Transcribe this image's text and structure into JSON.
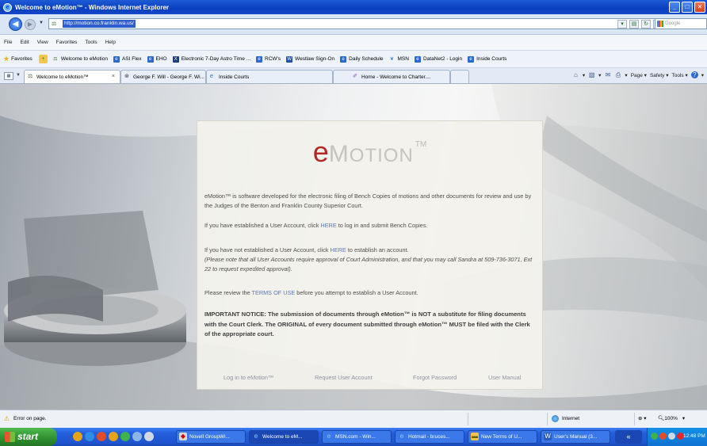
{
  "window": {
    "title": "Welcome to eMotion™ - Windows Internet Explorer"
  },
  "address": {
    "url": "http://motion.co.franklin.wa.us/",
    "search_placeholder": "Google"
  },
  "menu": [
    "File",
    "Edit",
    "View",
    "Favorites",
    "Tools",
    "Help"
  ],
  "favorites": {
    "label": "Favorites",
    "items": [
      "Welcome to eMotion",
      "ASI Flex",
      "EHO",
      "Electronic 7-Day Astro Time ...",
      "RCW's",
      "Westlaw Sign-On",
      "Daily Schedule",
      "MSN",
      "DataNet2 - Login",
      "Inside Courts"
    ]
  },
  "tabs": [
    "Welcome to eMotion™",
    "George F. Will - George F. Wi...",
    "Inside Courts",
    "Home - Welcome to Charter...."
  ],
  "toolbar": {
    "page": "Page",
    "safety": "Safety",
    "tools": "Tools"
  },
  "page": {
    "logo_e": "e",
    "logo_m": "M",
    "logo_rest": "OTION",
    "logo_tm": "TM",
    "intro": "eMotion™ is software developed for the electronic filing of Bench Copies of motions and other documents for review and use by the Judges of the Benton and Franklin County Superior Court.",
    "login_pre": "If you have established a User Account, click ",
    "login_link": "HERE",
    "login_post": " to log in and submit Bench Copies.",
    "register_pre": "If you have not established a User Account, click ",
    "register_link": "HERE",
    "register_post": " to establish an account.",
    "note": "(Please note that all User Accounts require approval of Court Administration, and that you may call Sandra at 509-736-3071, Ext 22 to request expedited approval).",
    "terms_pre": "Please review the ",
    "terms_link": "TERMS OF USE",
    "terms_post": " before you attempt to establish a User Account.",
    "notice": "IMPORTANT NOTICE: The submission of documents through eMotion™ is NOT a substitute for filing documents with the Court Clerk. The ORIGINAL of every document submitted through eMotion™ MUST be filed with the Clerk of the appropriate court.",
    "nav": [
      "Log in to eMotion™",
      "Request User Account",
      "Forgot Password",
      "User Manual"
    ]
  },
  "status": {
    "message": "Error on page.",
    "zone": "Internet",
    "zoom": "100%"
  },
  "taskbar": {
    "start": "start",
    "tasks": [
      "Novell GroupWi...",
      "Welcome to eM...",
      "MSN.com - Win...",
      "Hotmail - bruces...",
      "New Terms of U...",
      "User's Manual (3..."
    ],
    "clock": "12:48 PM"
  }
}
